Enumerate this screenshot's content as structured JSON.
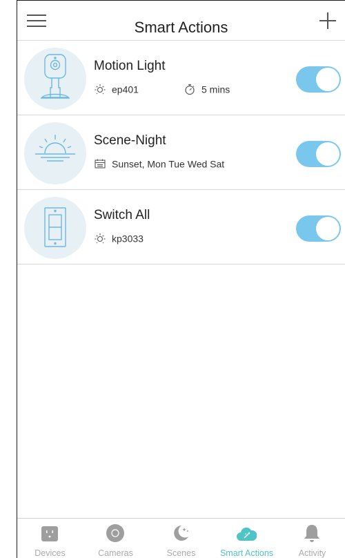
{
  "header": {
    "title": "Smart Actions",
    "menu_icon": "hamburger-menu-icon",
    "add_icon": "plus-icon"
  },
  "actions": [
    {
      "name": "Motion Light",
      "icon": "camera-icon",
      "details": [
        {
          "icon": "sun-icon",
          "text": "ep401"
        },
        {
          "icon": "timer-icon",
          "text": "5 mins"
        }
      ],
      "enabled": true
    },
    {
      "name": "Scene-Night",
      "icon": "sunset-icon",
      "details": [
        {
          "icon": "calendar-icon",
          "text": "Sunset, Mon Tue Wed Sat"
        }
      ],
      "enabled": true
    },
    {
      "name": "Switch All",
      "icon": "light-switch-icon",
      "details": [
        {
          "icon": "sun-icon",
          "text": "kp3033"
        }
      ],
      "enabled": true
    }
  ],
  "tabs": [
    {
      "label": "Devices",
      "icon": "plug-icon",
      "active": false
    },
    {
      "label": "Cameras",
      "icon": "camera-lens-icon",
      "active": false
    },
    {
      "label": "Scenes",
      "icon": "moon-stars-icon",
      "active": false
    },
    {
      "label": "Smart Actions",
      "icon": "cloud-wand-icon",
      "active": true
    },
    {
      "label": "Activity",
      "icon": "bell-icon",
      "active": false
    }
  ],
  "colors": {
    "accent": "#4fc3c5",
    "toggle_on": "#7ac7ee",
    "icon_circle_bg": "#e6f0f5",
    "icon_stroke": "#6bb8e0",
    "inactive_tab": "#aaaaaa"
  }
}
